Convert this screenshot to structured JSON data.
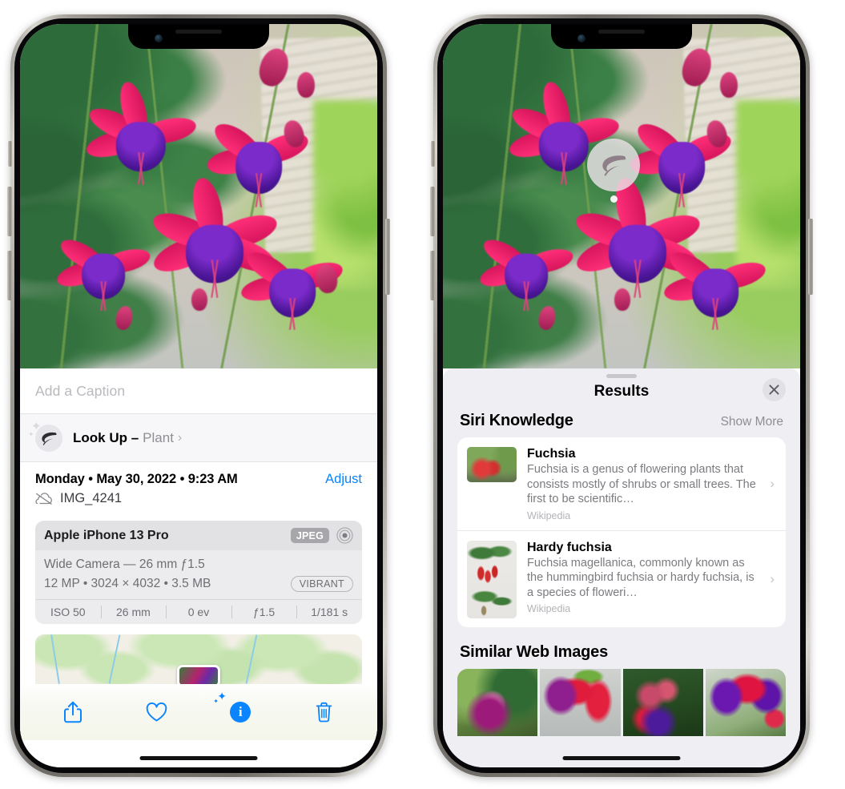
{
  "left_phone": {
    "caption": {
      "placeholder": "Add a Caption",
      "value": ""
    },
    "lookup": {
      "label": "Look Up –",
      "kind": "Plant",
      "icon": "leaf-icon",
      "chevron": "›"
    },
    "meta": {
      "date": "Monday • May 30, 2022 • 9:23 AM",
      "adjust_label": "Adjust",
      "filename": "IMG_4241",
      "cloud_icon": "cloud-slash-icon"
    },
    "camera_card": {
      "device": "Apple iPhone 13 Pro",
      "format_badge": "JPEG",
      "lens_icon": "lens-circle-icon",
      "lens_line": "Wide Camera — 26 mm ƒ1.5",
      "specs_line": "12 MP • 3024 × 4032 • 3.5 MB",
      "style_badge": "VIBRANT",
      "exif": [
        "ISO 50",
        "26 mm",
        "0 ev",
        "ƒ1.5",
        "1/181 s"
      ]
    },
    "toolbar": [
      {
        "name": "share-button",
        "icon": "share-icon"
      },
      {
        "name": "favorite-button",
        "icon": "heart-icon"
      },
      {
        "name": "info-button",
        "icon": "info-sparkle-icon"
      },
      {
        "name": "delete-button",
        "icon": "trash-icon"
      }
    ],
    "accent_color": "#0a84ff"
  },
  "right_phone": {
    "visual_lookup_badge": {
      "icon": "leaf-icon"
    },
    "results": {
      "title": "Results",
      "close_icon": "close-icon",
      "siri_knowledge": {
        "heading": "Siri Knowledge",
        "action": "Show More",
        "items": [
          {
            "title": "Fuchsia",
            "description": "Fuchsia is a genus of flowering plants that consists mostly of shrubs or small trees. The first to be scientific…",
            "source": "Wikipedia",
            "chevron": "›"
          },
          {
            "title": "Hardy fuchsia",
            "description": "Fuchsia magellanica, commonly known as the hummingbird fuchsia or hardy fuchsia, is a species of floweri…",
            "source": "Wikipedia",
            "chevron": "›"
          }
        ]
      },
      "similar_web_images": {
        "heading": "Similar Web Images",
        "count": 4
      }
    },
    "panel_color": "#efeef3"
  }
}
